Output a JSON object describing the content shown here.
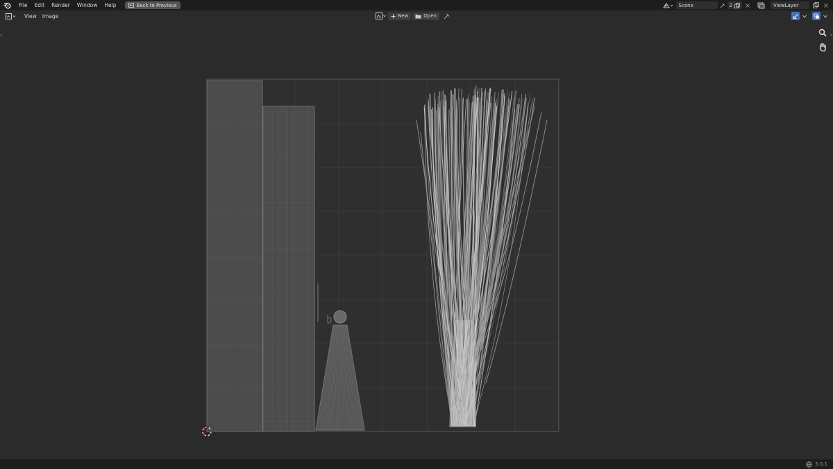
{
  "menu": {
    "items": [
      "File",
      "Edit",
      "Render",
      "Window",
      "Help"
    ],
    "back_label": "Back to Previous"
  },
  "top_right": {
    "scene_label": "Scene",
    "scene_users": "2",
    "viewlayer_label": "ViewLayer"
  },
  "header": {
    "view_label": "View",
    "image_label": "Image",
    "new_label": "New",
    "open_label": "Open"
  },
  "status": {
    "version": "5.0.1"
  },
  "colors": {
    "bg": "#2b2b2b",
    "topbar": "#1d1d1d",
    "accent": "#4772b3",
    "uv_lines": "#9a9a9a"
  },
  "icons": [
    "blender-logo-icon",
    "image-editor-icon",
    "image-browse-icon",
    "plus-icon",
    "folder-icon",
    "pin-icon",
    "gizmo-icon",
    "overlay-icon",
    "zoom-icon",
    "hand-pan-icon",
    "globe-icon",
    "cursor-2d-icon"
  ]
}
